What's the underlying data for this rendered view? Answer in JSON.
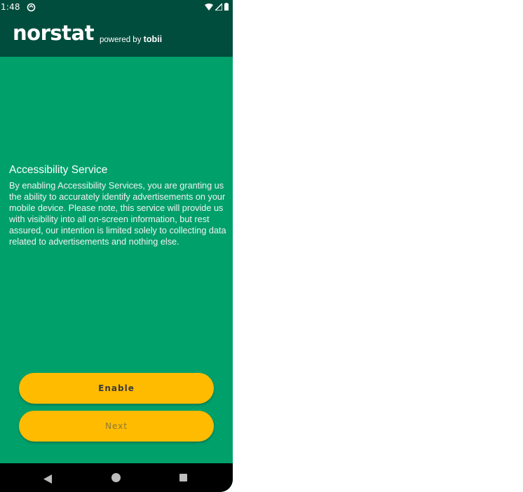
{
  "status_bar": {
    "time": "1:48",
    "icons": [
      "sync-icon",
      "wifi-icon",
      "signal-icon",
      "battery-icon"
    ]
  },
  "app_bar": {
    "brand": "norstat",
    "powered_prefix": "powered by ",
    "powered_brand": "tobii"
  },
  "main": {
    "title": "Accessibility Service",
    "description": "By enabling Accessibility Services, you are granting us the ability to accurately identify advertisements on your mobile device. Please note, this service will provide us with visibility into all on-screen information, but rest assured, our intention is limited solely to collecting data related to advertisements and nothing else."
  },
  "buttons": {
    "enable": "Enable",
    "next": "Next"
  },
  "nav_bar": {
    "icons": [
      "back-icon",
      "home-icon",
      "recents-icon"
    ]
  },
  "colors": {
    "header": "#004d3d",
    "background": "#00a06b",
    "button": "#ffbb00"
  }
}
